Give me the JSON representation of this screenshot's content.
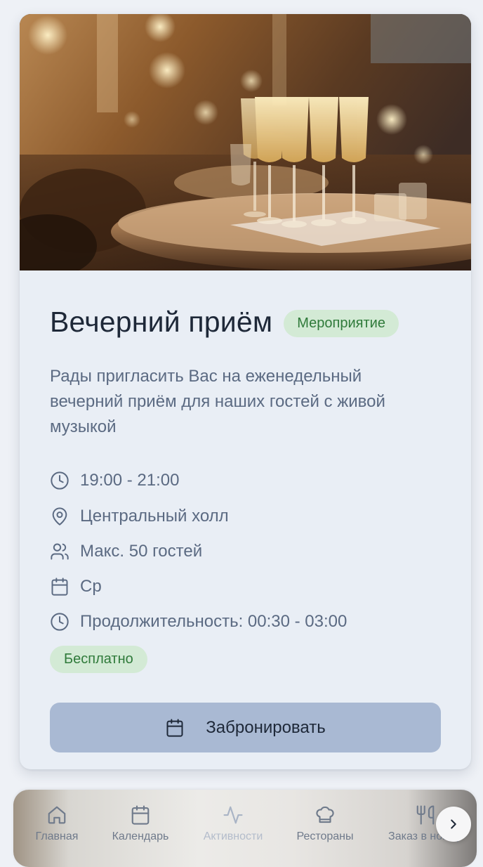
{
  "event": {
    "title": "Вечерний приём",
    "type_badge": "Мероприятие",
    "description": "Рады пригласить Вас на еженедельный вечерний приём для наших гостей с живой музыкой",
    "time": "19:00 - 21:00",
    "location": "Центральный холл",
    "capacity": "Макс. 50 гостей",
    "day": "Ср",
    "duration": "Продолжительность: 00:30 - 03:00",
    "price": "Бесплатно",
    "book_label": "Забронировать"
  },
  "nav": {
    "items": [
      {
        "label": "Главная",
        "icon": "home-icon"
      },
      {
        "label": "Календарь",
        "icon": "calendar-icon"
      },
      {
        "label": "Активности",
        "icon": "activity-icon"
      },
      {
        "label": "Рестораны",
        "icon": "chef-hat-icon"
      },
      {
        "label": "Заказ в номер",
        "icon": "utensils-icon"
      }
    ],
    "scroll_icon": "chevron-right-icon"
  },
  "colors": {
    "badge_bg": "#d3ead5",
    "badge_text": "#2f7a3a",
    "button_bg": "#a9b9d3",
    "muted_text": "#5b6a82"
  }
}
